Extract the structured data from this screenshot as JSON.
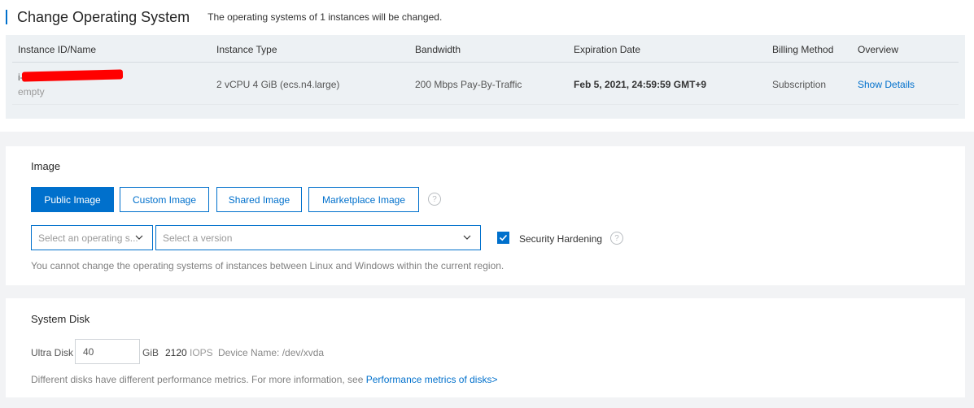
{
  "header": {
    "title": "Change Operating System",
    "subtitle": "The operating systems of 1 instances will be changed."
  },
  "table": {
    "columns": [
      "Instance ID/Name",
      "Instance Type",
      "Bandwidth",
      "Expiration Date",
      "Billing Method",
      "Overview"
    ],
    "rows": [
      {
        "id_prefix": "i-",
        "name": "empty",
        "type": "2 vCPU 4 GiB  (ecs.n4.large)",
        "bandwidth": "200 Mbps Pay-By-Traffic",
        "expiration": "Feb 5, 2021, 24:59:59 GMT+9",
        "billing": "Subscription",
        "overview": "Show Details"
      }
    ]
  },
  "image": {
    "title": "Image",
    "tabs": [
      "Public Image",
      "Custom Image",
      "Shared Image",
      "Marketplace Image"
    ],
    "active_tab": "Public Image",
    "os_placeholder": "Select an operating s...",
    "version_placeholder": "Select a version",
    "security_hardening_label": "Security Hardening",
    "security_hardening_checked": true,
    "note": "You cannot change the operating systems of instances between Linux and Windows within the current region."
  },
  "system_disk": {
    "title": "System Disk",
    "disk_type": "Ultra Disk",
    "size": "40",
    "unit": "GiB",
    "iops_value": "2120",
    "iops_label": "IOPS",
    "device": "Device Name: /dev/xvda",
    "note": "Different disks have different performance metrics. For more information, see",
    "link": "Performance metrics of disks>"
  },
  "colors": {
    "accent": "#0070cc",
    "redaction": "#ff0000"
  }
}
